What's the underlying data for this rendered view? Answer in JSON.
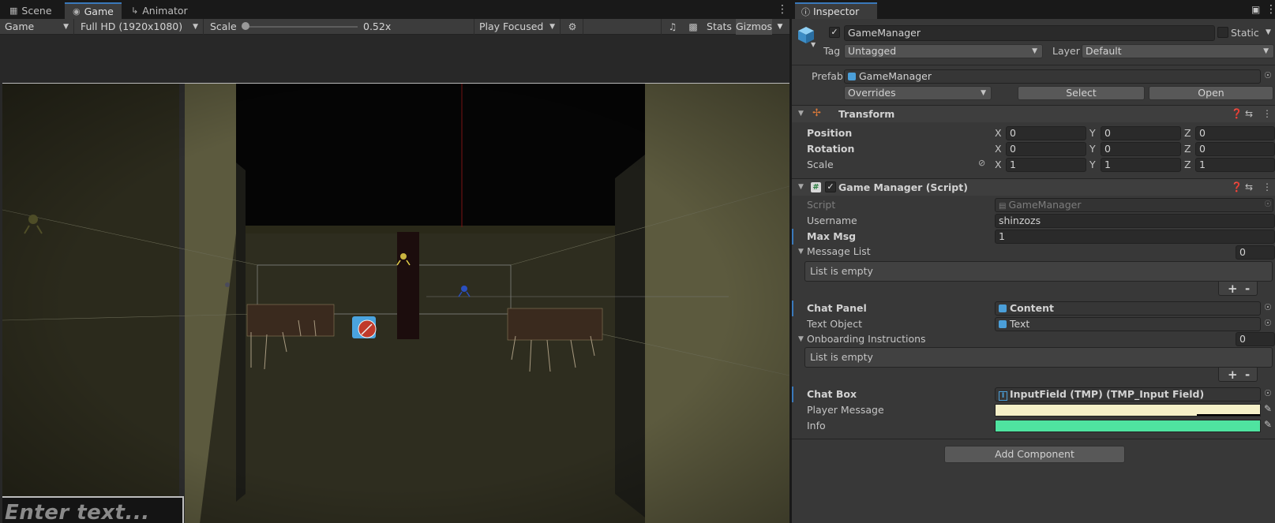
{
  "left": {
    "tabs": [
      {
        "label": "Scene",
        "icon": "grid-icon"
      },
      {
        "label": "Game",
        "icon": "gamepad-icon"
      },
      {
        "label": "Animator",
        "icon": "animator-icon"
      }
    ],
    "toolbar": {
      "display": "Game",
      "resolution": "Full HD (1920x1080)",
      "scale_label": "Scale",
      "scale_value": "0.52x",
      "scale_fraction": 0.02,
      "play_mode": "Play Focused",
      "stats": "Stats",
      "gizmos": "Gizmos"
    },
    "game_view": {
      "input_placeholder": "Enter text..."
    }
  },
  "inspector": {
    "tab": "Inspector",
    "object_name": "GameManager",
    "static_label": "Static",
    "tag_label": "Tag",
    "tag_value": "Untagged",
    "layer_label": "Layer",
    "layer_value": "Default",
    "prefab_label": "Prefab",
    "prefab_value": "GameManager",
    "overrides": "Overrides",
    "select_btn": "Select",
    "open_btn": "Open",
    "transform": {
      "title": "Transform",
      "rows": [
        {
          "label": "Position",
          "x": "0",
          "y": "0",
          "z": "0"
        },
        {
          "label": "Rotation",
          "x": "0",
          "y": "0",
          "z": "0"
        },
        {
          "label": "Scale",
          "x": "1",
          "y": "1",
          "z": "1"
        }
      ],
      "axis_x": "X",
      "axis_y": "Y",
      "axis_z": "Z"
    },
    "script_comp": {
      "title": "Game Manager (Script)",
      "script_label": "Script",
      "script_value": "GameManager",
      "username_label": "Username",
      "username_value": "shinzozs",
      "maxmsg_label": "Max Msg",
      "maxmsg_value": "1",
      "msglist_label": "Message List",
      "msglist_count": "0",
      "list_empty": "List is empty",
      "chatpanel_label": "Chat Panel",
      "chatpanel_value": "Content",
      "textobj_label": "Text Object",
      "textobj_value": "Text",
      "onboard_label": "Onboarding Instructions",
      "onboard_count": "0",
      "chatbox_label": "Chat Box",
      "chatbox_value": "InputField (TMP) (TMP_Input Field)",
      "playermsg_label": "Player Message",
      "playermsg_color": "#f5f0c8",
      "info_label": "Info",
      "info_color": "#4fe3a0",
      "plus": "+",
      "minus": "-"
    },
    "add_component": "Add Component"
  }
}
